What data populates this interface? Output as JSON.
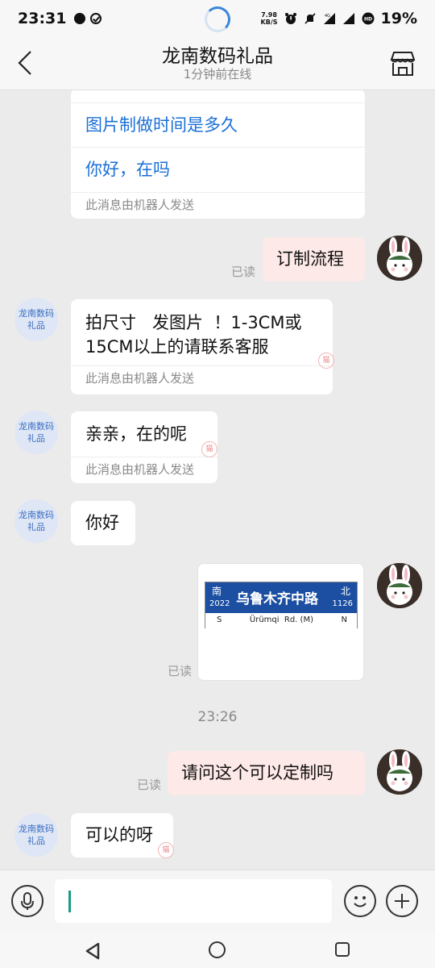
{
  "status_bar": {
    "time": "23:31",
    "net_speed_value": "7.98",
    "net_speed_unit": "KB/S",
    "network": "4G",
    "hd": "HD",
    "battery": "19%"
  },
  "header": {
    "title": "龙南数码礼品",
    "subtitle": "1分钟前在线"
  },
  "shop_avatar": {
    "line1": "龙南数码",
    "line2": "礼品"
  },
  "messages": {
    "quick_questions": [
      "图片制做时间是多久",
      "你好，在吗"
    ],
    "robot_note": "此消息由机器人发送",
    "read_label": "已读",
    "out_1": "订制流程",
    "in_1_line1": "拍尺寸   发图片  ！1-3CM或",
    "in_1_line2": "15CM以上的请联系客服",
    "in_2": "亲亲，在的呢",
    "in_3": "你好",
    "time_divider": "23:26",
    "out_3": "请问这个可以定制吗",
    "in_4": "可以的呀",
    "stamp": "猫"
  },
  "street_sign": {
    "south_cn": "南",
    "north_cn": "北",
    "name_cn": "乌鲁木齐中路",
    "left_number": "2022",
    "right_number": "1126",
    "south_en": "S",
    "name_en": "Ürümqi  Rd. (M)",
    "north_en": "N"
  },
  "input": {
    "value": ""
  },
  "icons": {
    "back": "chevron-left-icon",
    "store": "store-icon",
    "mic": "microphone-icon",
    "emoji": "smile-icon",
    "plus": "plus-icon"
  },
  "colors": {
    "link_blue": "#1a6fd8",
    "outgoing_bubble": "#fde9e7",
    "caret": "#1a9b86",
    "sign_blue": "#1c4fa1"
  }
}
